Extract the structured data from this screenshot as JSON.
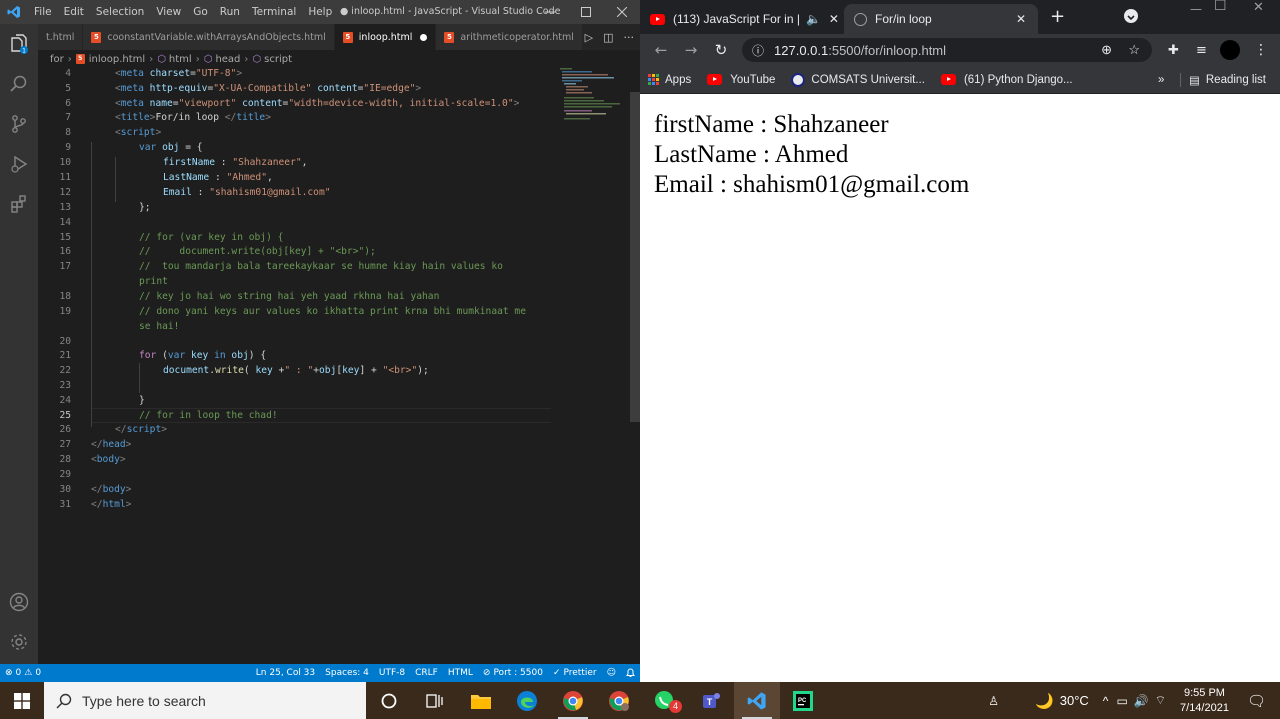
{
  "vscode": {
    "menu": [
      "File",
      "Edit",
      "Selection",
      "View",
      "Go",
      "Run",
      "Terminal",
      "Help"
    ],
    "window_title": "● inloop.html - JavaScript - Visual Studio Code",
    "tabs": [
      {
        "label": "t.html"
      },
      {
        "label": "coonstantVariable.withArraysAndObjects.html"
      },
      {
        "label": "inloop.html"
      },
      {
        "label": "arithmeticoperator.html"
      }
    ],
    "breadcrumb": [
      "for",
      "inloop.html",
      "html",
      "head",
      "script"
    ],
    "line_numbers": [
      "4",
      "5",
      "6",
      "7",
      "8",
      "9",
      "10",
      "11",
      "12",
      "13",
      "14",
      "15",
      "16",
      "17",
      "",
      "18",
      "19",
      "",
      "20",
      "21",
      "22",
      "23",
      "24",
      "25",
      "26",
      "27",
      "28",
      "29",
      "30",
      "31"
    ],
    "code": {
      "l4": [
        "<",
        "meta",
        " charset",
        "=",
        "\"UTF-8\"",
        ">"
      ],
      "l5": [
        "<",
        "meta",
        " http-equiv",
        "=",
        "\"X-UA-Compatible\"",
        " content",
        "=",
        "\"IE=edge\"",
        ">"
      ],
      "l6": [
        "<",
        "meta",
        " name",
        "=",
        "\"viewport\"",
        " content",
        "=",
        "\"width=device-width, initial-scale=1.0\"",
        ">"
      ],
      "l7": [
        "<",
        "title",
        ">",
        "For/in loop ",
        "</",
        "title",
        ">"
      ],
      "l8": [
        "<",
        "script",
        ">"
      ],
      "l9": [
        "var",
        " obj",
        " = {"
      ],
      "l10": [
        "firstName",
        " : ",
        "\"Shahzaneer\"",
        ","
      ],
      "l11": [
        "LastName",
        " : ",
        "\"Ahmed\"",
        ","
      ],
      "l12": [
        "Email",
        " : ",
        "\"shahism01@gmail.com\""
      ],
      "l13": [
        "};"
      ],
      "l15": "// for (var key in obj) {",
      "l16": "//     document.write(obj[key] + \"<br>\");",
      "l17a": "//  tou mandarja bala tareekaykaar se humne kiay hain values ko",
      "l17b": "print",
      "l18": "// key jo hai wo string hai yeh yaad rkhna hai yahan",
      "l19a": "// dono yani keys aur values ko ikhatta print krna bhi mumkinaat me",
      "l19b": "se hai!",
      "l21": [
        "for",
        " (",
        "var",
        " key",
        " in",
        " obj",
        ") {"
      ],
      "l22": [
        "document",
        ".",
        "write",
        "( ",
        "key",
        " +",
        "\" : \"",
        "+",
        "obj",
        "[",
        "key",
        "] + ",
        "\"<br>\"",
        ");"
      ],
      "l24": [
        "}"
      ],
      "l25": "// for in loop the chad!",
      "l26": [
        "</",
        "script",
        ">"
      ],
      "l27": [
        "</",
        "head",
        ">"
      ],
      "l28": [
        "<",
        "body",
        ">"
      ],
      "l30": [
        "</",
        "body",
        ">"
      ],
      "l31": [
        "</",
        "html",
        ">"
      ]
    },
    "status": {
      "errors": "0",
      "warnings": "0",
      "position": "Ln 25, Col 33",
      "spaces": "Spaces: 4",
      "encoding": "UTF-8",
      "eol": "CRLF",
      "language": "HTML",
      "port": "Port : 5500",
      "prettier": "Prettier"
    },
    "accent_color": "#007acc"
  },
  "chrome": {
    "tabs": [
      {
        "label": "(113) JavaScript For in |"
      },
      {
        "label": "For/in loop"
      }
    ],
    "url_host": "127.0.0.1",
    "url_rest": ":5500/for/inloop.html",
    "bookmarks": [
      "Apps",
      "YouTube",
      "COMSATS Universit...",
      "(61) Python Django..."
    ],
    "reading_list": "Reading list",
    "page_lines": [
      "firstName : Shahzaneer",
      "LastName : Ahmed",
      "Email : shahism01@gmail.com"
    ]
  },
  "taskbar": {
    "search_placeholder": "Type here to search",
    "temperature": "30°C",
    "time": "9:55 PM",
    "date": "7/14/2021",
    "whatsapp_badge": "4"
  }
}
